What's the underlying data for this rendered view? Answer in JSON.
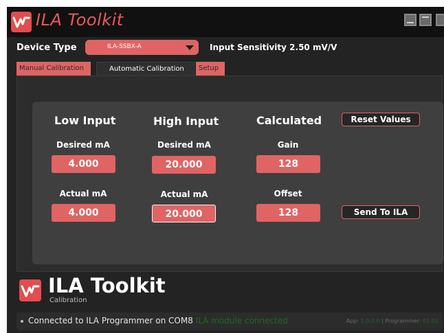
{
  "window": {
    "title": "ILA Toolkit",
    "icons": [
      "app-logo-icon",
      "minimize-icon",
      "maximize-icon",
      "close-icon"
    ]
  },
  "device": {
    "label": "Device Type",
    "selected": "ILA-SSBX-A",
    "sensitivity": "Input Sensitivity 2.50 mV/V"
  },
  "tabs": [
    {
      "label": "Manual Calibration",
      "active": false
    },
    {
      "label": "Automatic Calibration",
      "active": true
    },
    {
      "label": "Setup",
      "active": false
    }
  ],
  "calibration": {
    "low": {
      "heading": "Low Input",
      "desired_label": "Desired mA",
      "desired_value": "4.000",
      "actual_label": "Actual mA",
      "actual_value": "4.000"
    },
    "high": {
      "heading": "High Input",
      "desired_label": "Desired mA",
      "desired_value": "20.000",
      "actual_label": "Actual mA",
      "actual_value": "20.000"
    },
    "calculated": {
      "heading": "Calculated",
      "gain_label": "Gain",
      "gain_value": "128",
      "offset_label": "Offset",
      "offset_value": "128"
    },
    "reset_button": "Reset Values",
    "send_button": "Send To ILA"
  },
  "brand": {
    "title": "ILA Toolkit",
    "subtitle": "Calibration"
  },
  "status": {
    "message": "Connected to ILA Programmer on COM8",
    "module_status": "ILA module connected",
    "app_label": "App:",
    "app_version": "1.0.2.0",
    "programmer_label": "| Programmer:",
    "programmer_version": "01.01"
  },
  "colors": {
    "accent": "#e06464",
    "background": "#232323",
    "panel": "#3f3f3f",
    "status_ok": "#1f6a1f"
  }
}
